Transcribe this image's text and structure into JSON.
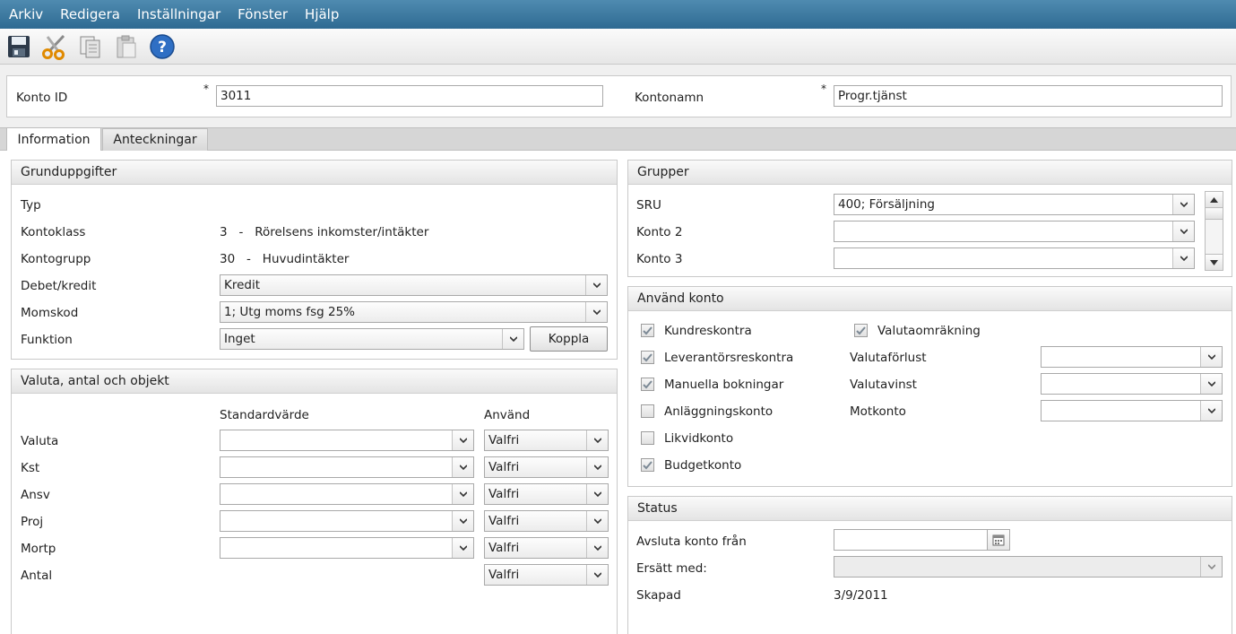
{
  "menu": [
    "Arkiv",
    "Redigera",
    "Inställningar",
    "Fönster",
    "Hjälp"
  ],
  "toolbar": [
    {
      "icon": "save-icon"
    },
    {
      "icon": "cut-icon"
    },
    {
      "icon": "copy-icon"
    },
    {
      "icon": "paste-icon"
    },
    {
      "icon": "help-icon"
    }
  ],
  "header": {
    "konto_id_label": "Konto ID",
    "konto_id_value": "3011",
    "kontonamn_label": "Kontonamn",
    "kontonamn_value": "Progr.tjänst",
    "required_mark": "*"
  },
  "tabs": [
    "Information",
    "Anteckningar"
  ],
  "grund": {
    "title": "Grunduppgifter",
    "typ_label": "Typ",
    "kontoklass_label": "Kontoklass",
    "kontoklass_value": "3   -   Rörelsens inkomster/intäkter",
    "kontogrupp_label": "Kontogrupp",
    "kontogrupp_value": "30   -   Huvudintäkter",
    "debet_label": "Debet/kredit",
    "debet_value": "Kredit",
    "moms_label": "Momskod",
    "moms_value": "1; Utg moms fsg 25%",
    "funktion_label": "Funktion",
    "funktion_value": "Inget",
    "koppla_label": "Koppla"
  },
  "valuta": {
    "title": "Valuta, antal och objekt",
    "col_standard": "Standardvärde",
    "col_anvand": "Använd",
    "rows": [
      {
        "label": "Valuta",
        "use": "Valfri"
      },
      {
        "label": "Kst",
        "use": "Valfri"
      },
      {
        "label": "Ansv",
        "use": "Valfri"
      },
      {
        "label": "Proj",
        "use": "Valfri"
      },
      {
        "label": "Mortp",
        "use": "Valfri"
      },
      {
        "label": "Antal",
        "use": "Valfri"
      }
    ]
  },
  "grupper": {
    "title": "Grupper",
    "rows": [
      {
        "label": "SRU",
        "value": "400; Försäljning"
      },
      {
        "label": "Konto 2",
        "value": ""
      },
      {
        "label": "Konto 3",
        "value": ""
      }
    ]
  },
  "anvand": {
    "title": "Använd konto",
    "checks": [
      {
        "label": "Kundreskontra",
        "checked": true
      },
      {
        "label": "Leverantörsreskontra",
        "checked": true
      },
      {
        "label": "Manuella bokningar",
        "checked": true
      },
      {
        "label": "Anläggningskonto",
        "checked": false
      },
      {
        "label": "Likvidkonto",
        "checked": false
      },
      {
        "label": "Budgetkonto",
        "checked": true
      }
    ],
    "valutaomr_label": "Valutaomräkning",
    "valutaomr_checked": true,
    "valutaforlust_label": "Valutaförlust",
    "valutavinst_label": "Valutavinst",
    "motkonto_label": "Motkonto"
  },
  "status": {
    "title": "Status",
    "avsluta_label": "Avsluta konto från",
    "ersatt_label": "Ersätt med:",
    "skapad_label": "Skapad",
    "skapad_value": "3/9/2011"
  }
}
